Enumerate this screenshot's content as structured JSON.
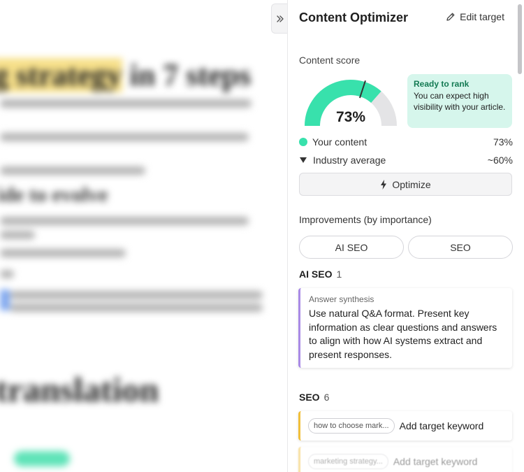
{
  "panel": {
    "title": "Content Optimizer",
    "edit_target_label": "Edit target",
    "score_label": "Content score",
    "score": {
      "value": 73,
      "display": "73%",
      "industry_average": 60
    },
    "rank_box": {
      "title": "Ready to rank",
      "text": "You can expect high visibility with your article."
    },
    "legend": {
      "your_content_label": "Your content",
      "your_content_value": "73%",
      "industry_label": "Industry average",
      "industry_value": "~60%"
    },
    "optimize_label": "Optimize",
    "improvements_label": "Improvements (by importance)",
    "tabs": [
      {
        "label": "AI SEO"
      },
      {
        "label": "SEO"
      }
    ],
    "ai_seo_section": {
      "label": "AI SEO",
      "count": "1"
    },
    "ai_seo_card": {
      "category": "Answer synthesis",
      "text": "Use natural Q&A format. Present key information as clear questions and answers to align with how AI systems extract and present responses."
    },
    "seo_section": {
      "label": "SEO",
      "count": "6"
    },
    "seo_cards": [
      {
        "keyword": "how to choose mark...",
        "action": "Add target keyword"
      },
      {
        "keyword": "marketing strategy...",
        "action": "Add target keyword"
      }
    ]
  },
  "colors": {
    "gauge_fill": "#38e1ac",
    "gauge_track": "#e4e4e6",
    "rank_bg": "#d6f6ec",
    "ai_accent": "#a98ae6",
    "seo_accent": "#f1bf3a"
  },
  "icons": {
    "collapse": "double-chevron-right-icon",
    "edit": "pencil-icon",
    "optimize": "lightning-bolt-icon"
  }
}
